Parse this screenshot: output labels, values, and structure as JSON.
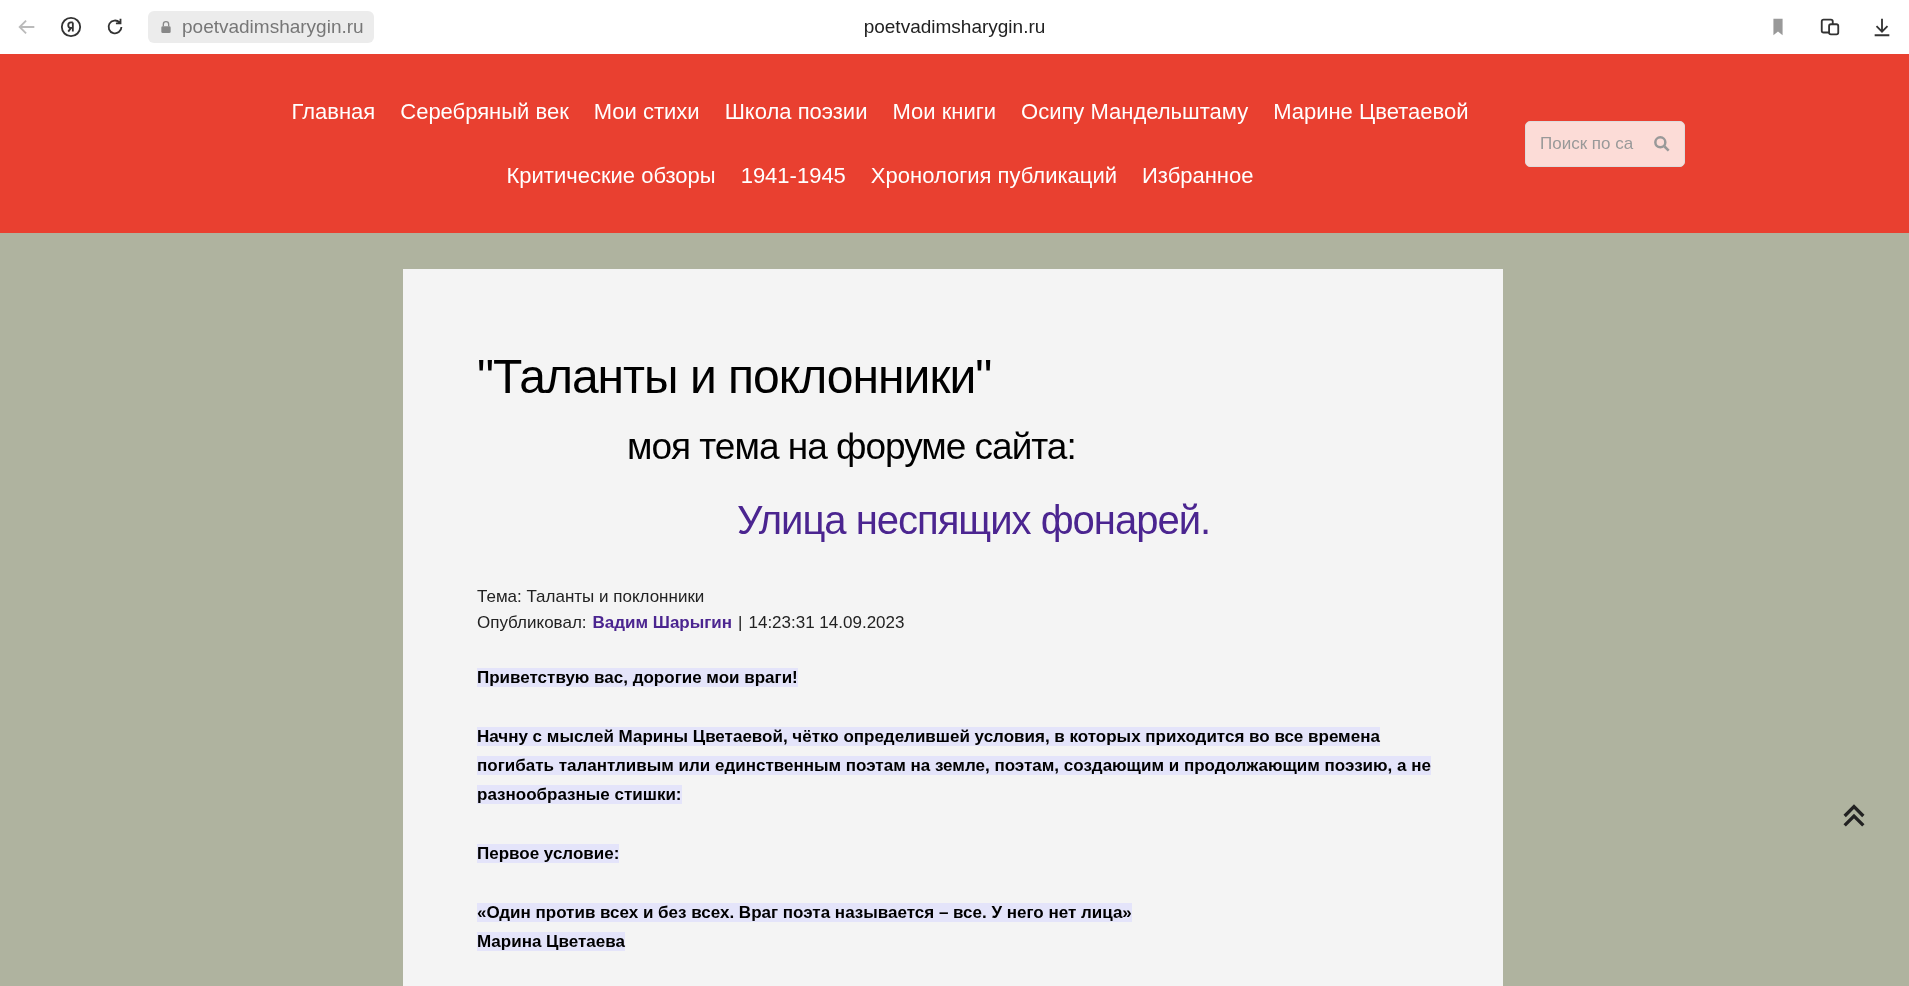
{
  "browser": {
    "address": "poetvadimsharygin.ru",
    "title": "poetvadimsharygin.ru"
  },
  "nav": {
    "items": [
      "Главная",
      "Серебряный век",
      "Мои стихи",
      "Школа поэзии",
      "Мои книги",
      "Осипу Мандельштаму",
      "Марине Цветаевой",
      "Критические обзоры",
      "1941-1945",
      "Хронология публикаций",
      "Избранное"
    ],
    "search": {
      "placeholder": "Поиск по са"
    }
  },
  "article": {
    "title": "\"Таланты и поклонники\"",
    "subtitle": "моя тема на форуме сайта:",
    "link": "Улица неспящих фонарей.",
    "topic": "Тема: Таланты и поклонники",
    "posted_label": "Опубликовал:",
    "author": "Вадим Шарыгин",
    "separator": "|",
    "timestamp": "14:23:31 14.09.2023",
    "paragraphs": [
      {
        "lines": [
          "Приветствую вас, дорогие мои враги!"
        ]
      },
      {
        "lines": [
          "Начну с мыслей Марины Цветаевой, чётко определившей условия, в которых приходится во все времена погибать талантливым или единственным поэтам на земле, поэтам, создающим и продолжающим поэзию, а не разнообразные стишки:"
        ]
      },
      {
        "lines": [
          "Первое условие:"
        ]
      },
      {
        "lines": [
          "«Один против всех и без всех. Враг поэта называется – все. У него нет лица»",
          "Марина Цветаева"
        ]
      }
    ]
  }
}
